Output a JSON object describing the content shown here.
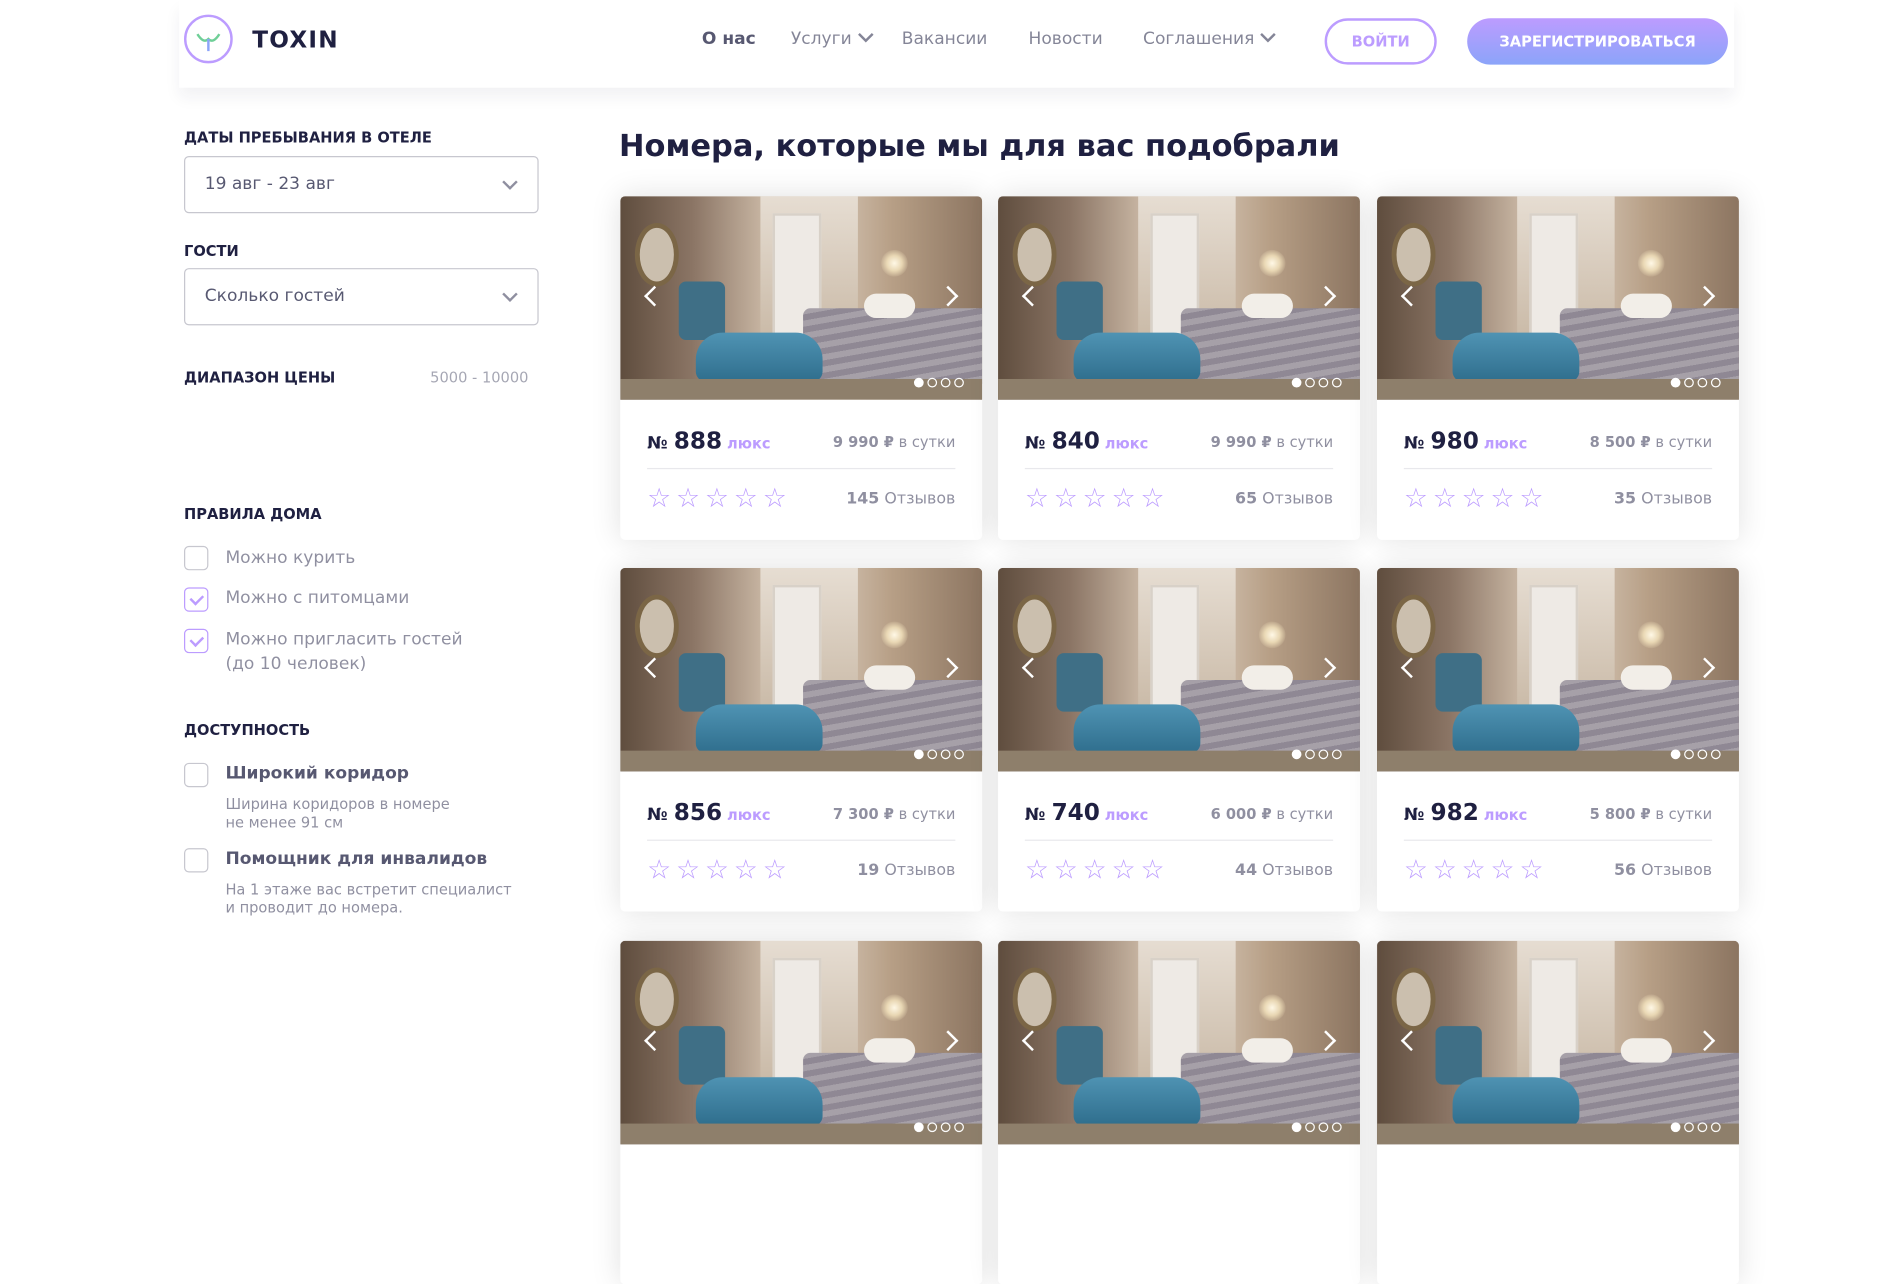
{
  "header": {
    "logo_text": "TOXIN",
    "nav": [
      {
        "label": "О нас",
        "active": true,
        "has_dropdown": false
      },
      {
        "label": "Услуги",
        "active": false,
        "has_dropdown": true
      },
      {
        "label": "Вакансии",
        "active": false,
        "has_dropdown": false
      },
      {
        "label": "Новости",
        "active": false,
        "has_dropdown": false
      },
      {
        "label": "Соглашения",
        "active": false,
        "has_dropdown": true
      }
    ],
    "login_label": "ВОЙТИ",
    "register_label": "ЗАРЕГИСТРИРОВАТЬСЯ"
  },
  "sidebar": {
    "dates_label": "ДАТЫ ПРЕБЫВАНИЯ В ОТЕЛЕ",
    "dates_value": "19 авг - 23 авг",
    "guests_label": "ГОСТИ",
    "guests_value": "Сколько гостей",
    "price_label": "ДИАПАЗОН ЦЕНЫ",
    "price_value": "5000 - 10000",
    "rules_label": "ПРАВИЛА ДОМА",
    "rules": [
      {
        "label": "Можно курить",
        "checked": false
      },
      {
        "label": "Можно с питомцами",
        "checked": true
      },
      {
        "label": "Можно пригласить гостей",
        "label2": "(до 10 человек)",
        "checked": true
      }
    ],
    "accessibility_label": "ДОСТУПНОСТЬ",
    "accessibility": [
      {
        "title": "Широкий коридор",
        "desc1": "Ширина коридоров в номере",
        "desc2": "не менее 91 см",
        "checked": false
      },
      {
        "title": "Помощник для инвалидов",
        "desc1": "На 1 этаже вас встретит специалист",
        "desc2": "и проводит до номера.",
        "checked": false
      }
    ]
  },
  "main": {
    "title": "Номера, которые мы для вас подобрали",
    "room_prefix": "№",
    "lux_label": "люкс",
    "per_day": "в сутки",
    "reviews_word": "Отзывов",
    "stars": "☆☆☆☆☆",
    "rooms": [
      {
        "number": "888",
        "price": "9 990 ₽",
        "reviews": "145",
        "rating": 0
      },
      {
        "number": "840",
        "price": "9 990 ₽",
        "reviews": "65",
        "rating": 0
      },
      {
        "number": "980",
        "price": "8 500 ₽",
        "reviews": "35",
        "rating": 0
      },
      {
        "number": "856",
        "price": "7 300 ₽",
        "reviews": "19",
        "rating": 0
      },
      {
        "number": "740",
        "price": "6 000 ₽",
        "reviews": "44",
        "rating": 0
      },
      {
        "number": "982",
        "price": "5 800 ₽",
        "reviews": "56",
        "rating": 0
      }
    ],
    "slider_dots": 4,
    "active_dot": 0
  },
  "colors": {
    "accent": "#bc9cff",
    "accent2": "#8ba4f9",
    "text_dark": "#1f2041"
  }
}
